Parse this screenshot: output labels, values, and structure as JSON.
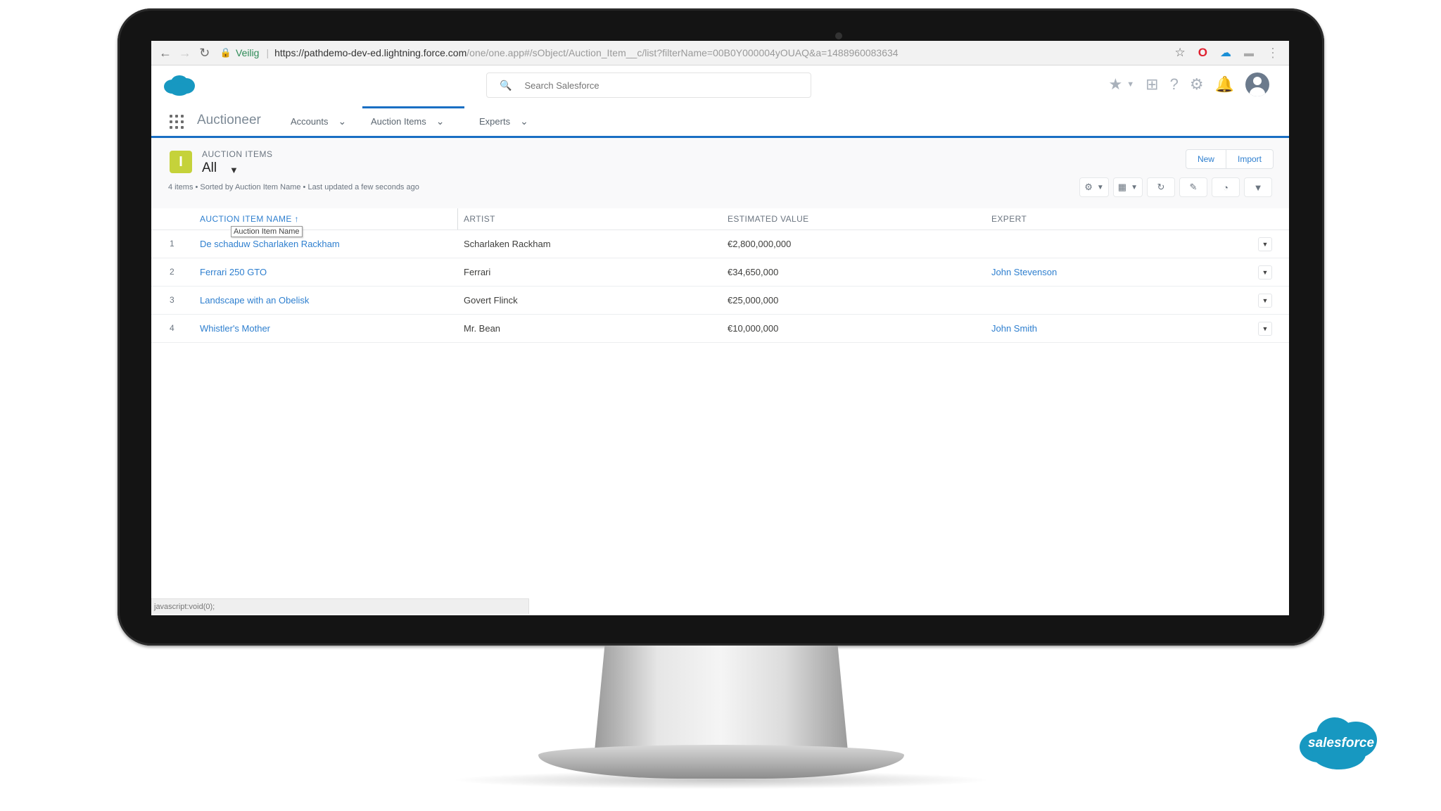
{
  "browser": {
    "secure_label": "Veilig",
    "url_main": "https://pathdemo-dev-ed.lightning.force.com",
    "url_rest": "/one/one.app#/sObject/Auction_Item__c/list?filterName=00B0Y000004yOUAQ&a=1488960083634",
    "icons": [
      "back-icon",
      "forward-icon",
      "reload-icon",
      "lock-icon",
      "star-icon",
      "opera-icon",
      "cloud-icon",
      "extension-icon",
      "kebab-icon"
    ]
  },
  "header": {
    "search_placeholder": "Search Salesforce"
  },
  "nav": {
    "app_name": "Auctioneer",
    "tabs": [
      {
        "label": "Accounts"
      },
      {
        "label": "Auction Items"
      },
      {
        "label": "Experts"
      }
    ]
  },
  "list": {
    "object_label": "AUCTION ITEMS",
    "view_name": "All",
    "new_label": "New",
    "import_label": "Import",
    "meta": "4 items • Sorted by Auction Item Name • Last updated a few seconds ago",
    "columns": [
      "AUCTION ITEM NAME",
      "ARTIST",
      "ESTIMATED VALUE",
      "EXPERT"
    ],
    "tooltip": "Auction Item Name",
    "rows": [
      {
        "num": "1",
        "name": "De schaduw Scharlaken Rackham",
        "artist": "Scharlaken Rackham",
        "value": "€2,800,000,000",
        "expert": ""
      },
      {
        "num": "2",
        "name": "Ferrari 250 GTO",
        "artist": "Ferrari",
        "value": "€34,650,000",
        "expert": "John Stevenson"
      },
      {
        "num": "3",
        "name": "Landscape with an Obelisk",
        "artist": "Govert Flinck",
        "value": "€25,000,000",
        "expert": ""
      },
      {
        "num": "4",
        "name": "Whistler's Mother",
        "artist": "Mr. Bean",
        "value": "€10,000,000",
        "expert": "John Smith"
      }
    ]
  },
  "status_bar": "javascript:void(0);",
  "brand_badge": "salesforce",
  "colors": {
    "accent": "#1a6fc3",
    "link": "#2e7fcf",
    "brand": "#1798c1",
    "object_icon": "#c5d23a"
  }
}
